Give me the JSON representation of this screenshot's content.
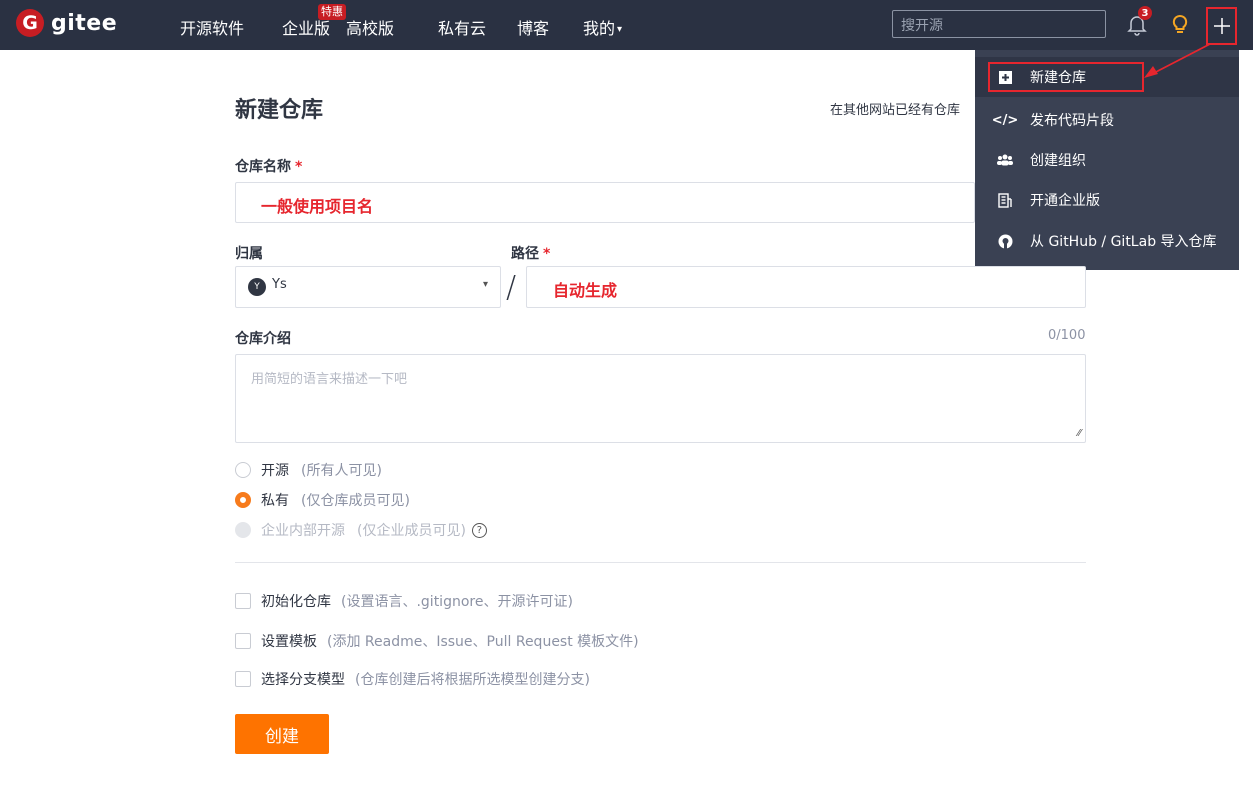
{
  "brand": {
    "mark": "G",
    "name": "gitee"
  },
  "nav": {
    "items": [
      "开源软件",
      "企业版",
      "高校版",
      "私有云",
      "博客",
      "我的"
    ],
    "promo_badge": "特惠",
    "search_placeholder": "搜开源",
    "notifications_count": "3"
  },
  "dropdown": {
    "items": [
      {
        "icon": "plus-square-icon",
        "label": "新建仓库"
      },
      {
        "icon": "code-icon",
        "label": "发布代码片段"
      },
      {
        "icon": "group-icon",
        "label": "创建组织"
      },
      {
        "icon": "building-icon",
        "label": "开通企业版"
      },
      {
        "icon": "github-icon",
        "label": "从 GitHub / GitLab 导入仓库"
      }
    ]
  },
  "form": {
    "title": "新建仓库",
    "import_hint": "在其他网站已经有仓库",
    "repo_name_label": "仓库名称",
    "required_mark": "*",
    "repo_name_annotation": "一般使用项目名",
    "owner_label": "归属",
    "owner_avatar": "Y",
    "owner_value": "Ys",
    "path_label": "路径",
    "path_annotation": "自动生成",
    "desc_label": "仓库介绍",
    "desc_counter": "0/100",
    "desc_placeholder": "用简短的语言来描述一下吧",
    "visibility": [
      {
        "label": "开源",
        "hint": "(所有人可见)",
        "state": "unchecked"
      },
      {
        "label": "私有",
        "hint": "(仅仓库成员可见)",
        "state": "checked"
      },
      {
        "label": "企业内部开源",
        "hint": "(仅企业成员可见)",
        "state": "disabled"
      }
    ],
    "options": [
      {
        "label": "初始化仓库",
        "hint": "(设置语言、.gitignore、开源许可证)"
      },
      {
        "label": "设置模板",
        "hint": "(添加 Readme、Issue、Pull Request 模板文件)"
      },
      {
        "label": "选择分支模型",
        "hint": "(仓库创建后将根据所选模型创建分支)"
      }
    ],
    "create_label": "创建"
  },
  "colors": {
    "nav_bg": "#2a3142",
    "accent": "#fe7300",
    "annotation_red": "#e6262e"
  }
}
